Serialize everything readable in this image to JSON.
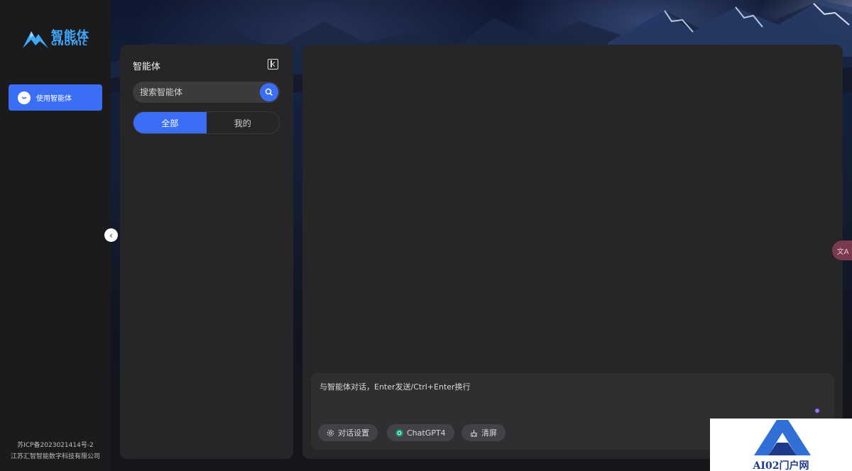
{
  "brand": {
    "name_cn": "智能体",
    "name_en": "GNOMIC"
  },
  "sidebar": {
    "items": [
      {
        "label": "使用智能体",
        "icon": "chat-bubble-icon",
        "active": true
      }
    ]
  },
  "footer": {
    "icp": "苏ICP备2023021414号-2",
    "company": "江苏汇智智能数字科技有限公司"
  },
  "agent_panel": {
    "title": "智能体",
    "search_placeholder": "搜索智能体",
    "tabs": [
      {
        "label": "全部",
        "active": true
      },
      {
        "label": "我的",
        "active": false
      }
    ]
  },
  "chat": {
    "input_placeholder": "与智能体对话，Enter发送/Ctrl+Enter换行",
    "toolbar": {
      "settings_label": "对话设置",
      "model_label": "ChatGPT4",
      "clear_label": "清屏"
    }
  },
  "translate": {
    "label": "文A"
  },
  "watermark": {
    "text": "AI02门户网"
  },
  "colors": {
    "accent": "#3a6ef5",
    "panel": "#262628",
    "nav_bg": "#1b1b1d",
    "brand_blue": "#3fa9ff"
  }
}
